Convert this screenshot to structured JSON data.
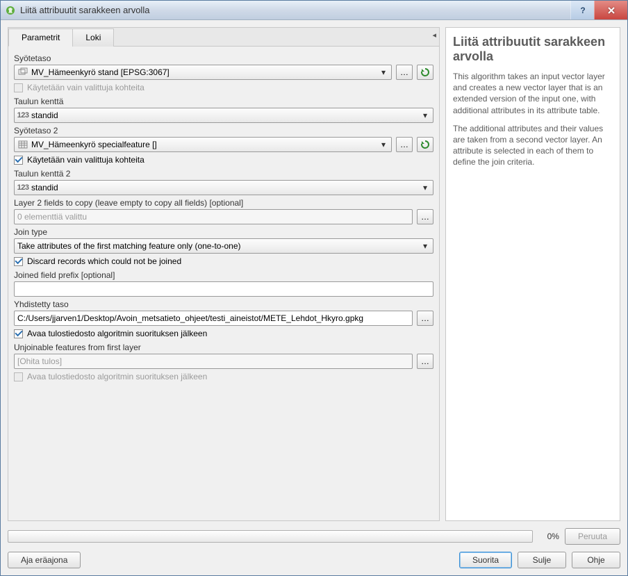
{
  "window": {
    "title": "Liitä attribuutit sarakkeen arvolla"
  },
  "tabs": {
    "param": "Parametrit",
    "log": "Loki"
  },
  "form": {
    "input1_label": "Syötetaso",
    "input1_value": "MV_Hämeenkyrö stand [EPSG:3067]",
    "selonly1_label": "Käytetään vain valittuja kohteita",
    "field1_label": "Taulun kenttä",
    "field1_value": "standid",
    "input2_label": "Syötetaso 2",
    "input2_value": "MV_Hämeenkyrö specialfeature []",
    "selonly2_label": "Käytetään vain valittuja kohteita",
    "field2_label": "Taulun kenttä 2",
    "field2_value": "standid",
    "copyfields_label": "Layer 2 fields to copy (leave empty to copy all fields) [optional]",
    "copyfields_placeholder": "0 elementtiä valittu",
    "jointype_label": "Join type",
    "jointype_value": "Take attributes of the first matching feature only (one-to-one)",
    "discard_label": "Discard records which could not be joined",
    "prefix_label": "Joined field prefix [optional]",
    "prefix_value": "",
    "output_label": "Yhdistetty taso",
    "output_value": "C:/Users/jjarven1/Desktop/Avoin_metsatieto_ohjeet/testi_aineistot/METE_Lehdot_Hkyro.gpkg",
    "openout1_label": "Avaa tulostiedosto algoritmin suorituksen jälkeen",
    "unjoin_label": "Unjoinable features from first layer",
    "unjoin_placeholder": "[Ohita tulos]",
    "openout2_label": "Avaa tulostiedosto algoritmin suorituksen jälkeen"
  },
  "help": {
    "title": "Liitä attribuutit sarakkeen arvolla",
    "p1": "This algorithm takes an input vector layer and creates a new vector layer that is an extended version of the input one, with additional attributes in its attribute table.",
    "p2": "The additional attributes and their values are taken from a second vector layer. An attribute is selected in each of them to define the join criteria."
  },
  "progress": {
    "pct": "0%"
  },
  "buttons": {
    "batch": "Aja eräajona",
    "cancel": "Peruuta",
    "run": "Suorita",
    "close": "Sulje",
    "help": "Ohje"
  }
}
